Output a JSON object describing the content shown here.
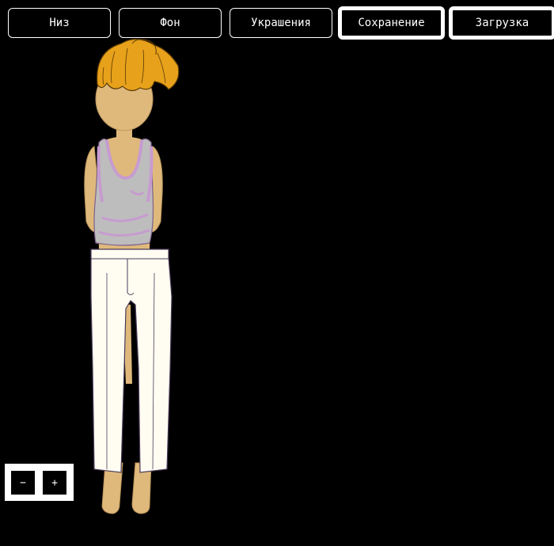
{
  "menu": {
    "tabs": [
      {
        "label": "Низ"
      },
      {
        "label": "Фон"
      },
      {
        "label": "Украшения"
      },
      {
        "label": "Сохранение"
      },
      {
        "label": "Загрузка"
      }
    ]
  },
  "zoom": {
    "minus_label": "−",
    "plus_label": "+"
  },
  "colors": {
    "background": "#000000",
    "skin": "#dfb97c",
    "hair": "#e7a11a",
    "top": "#bdbdbd",
    "top_accent": "#c79bd0",
    "pants": "#fffdf1"
  }
}
